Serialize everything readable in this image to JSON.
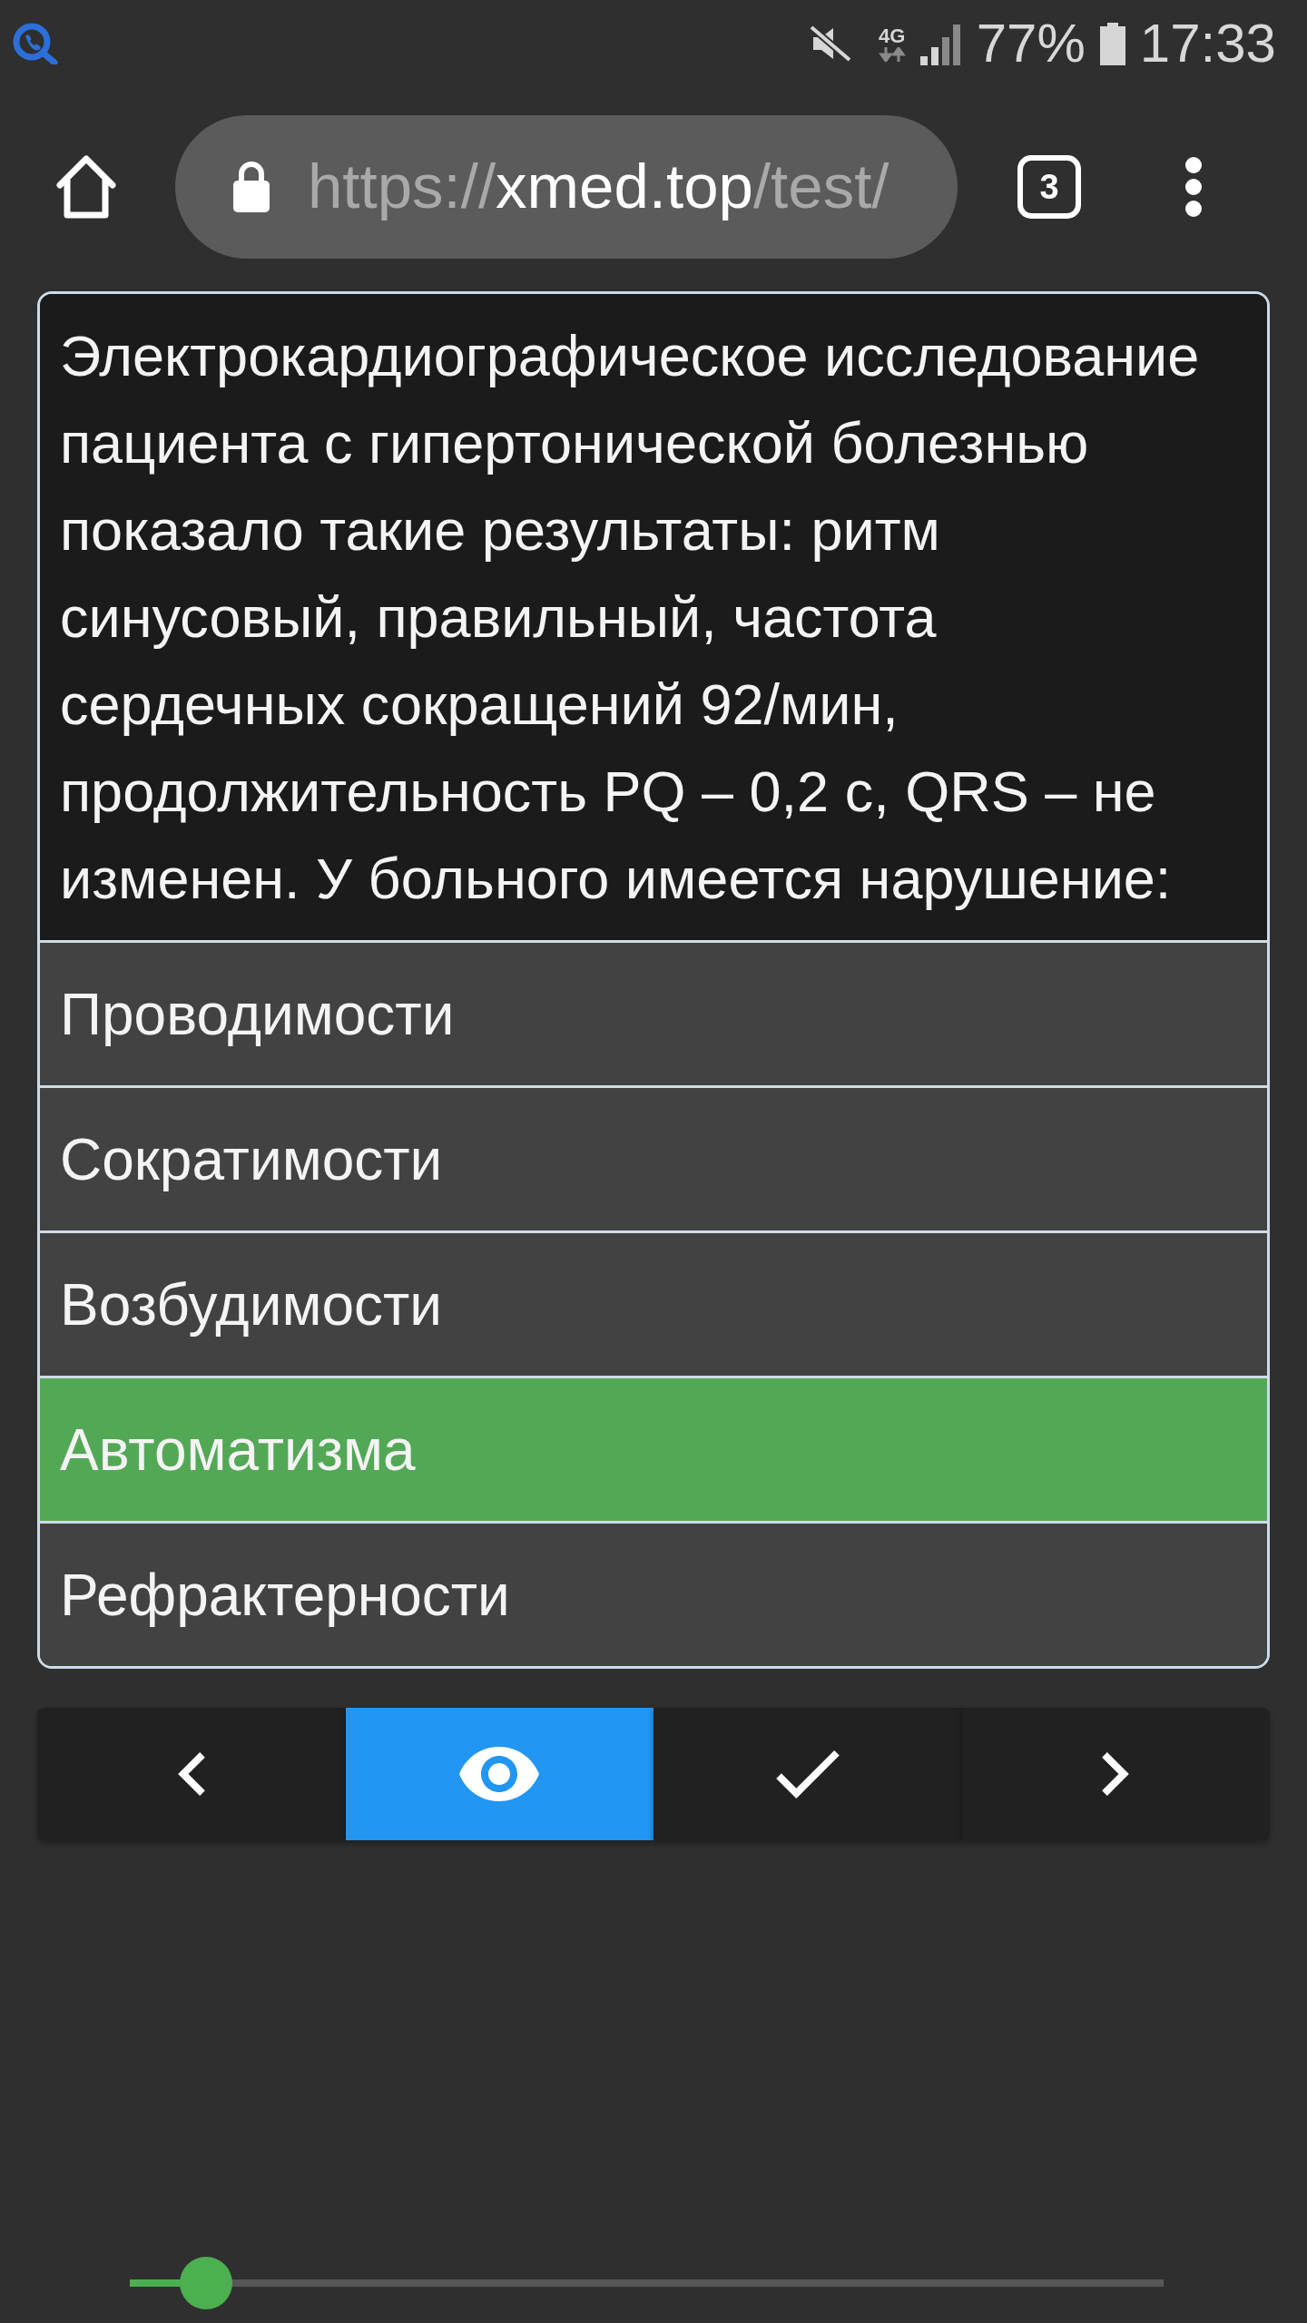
{
  "status_bar": {
    "network": "4G",
    "battery": "77%",
    "time": "17:33"
  },
  "browser_toolbar": {
    "address": {
      "scheme": "https://",
      "host": "xmed.top",
      "path": "/test/"
    },
    "tab_count": "3"
  },
  "question": {
    "text": "Электрокардиографическое исследование пациента с гипертонической болезнью показало такие результаты: ритм синусовый, правильный, частота сердечных сокращений 92/мин, продолжительность PQ – 0,2 с, QRS – не изменен. У больного имеется нарушение:"
  },
  "answers": [
    {
      "text": "Проводимости",
      "selected": false
    },
    {
      "text": "Сократимости",
      "selected": false
    },
    {
      "text": "Возбудимости",
      "selected": false
    },
    {
      "text": "Автоматизма",
      "selected": true
    },
    {
      "text": "Рефрактерности",
      "selected": false
    }
  ],
  "nav_buttons": [
    {
      "kind": "previous",
      "active": false
    },
    {
      "kind": "show",
      "active": true
    },
    {
      "kind": "check",
      "active": false
    },
    {
      "kind": "next",
      "active": false
    }
  ],
  "slider": {
    "level": 0.074
  }
}
